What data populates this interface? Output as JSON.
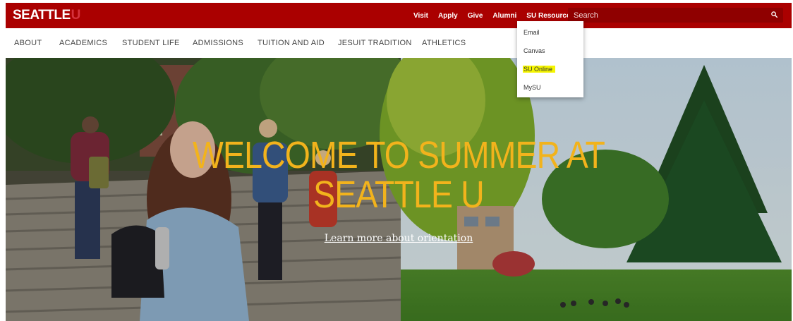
{
  "topbar": {
    "logo_text": "SEATTLE",
    "logo_accent": "U",
    "links": [
      "Visit",
      "Apply",
      "Give",
      "Alumni"
    ],
    "resources_label": "SU Resources",
    "search_placeholder": "Search",
    "bg_color": "#aa0000"
  },
  "nav": {
    "items": [
      "ABOUT",
      "ACADEMICS",
      "STUDENT LIFE",
      "ADMISSIONS",
      "TUITION AND AID",
      "JESUIT TRADITION",
      "ATHLETICS"
    ]
  },
  "dropdown": {
    "items": [
      "Email",
      "Canvas",
      "SU Online",
      "MySU"
    ],
    "highlighted": "SU Online"
  },
  "hero": {
    "headline_line1": "WELCOME TO SUMMER AT",
    "headline_line2": "SEATTLE U",
    "cta": "Learn more about orientation",
    "headline_color": "#f2b31c"
  },
  "icons": {
    "search": "search-icon",
    "caret": "chevron-down-icon"
  }
}
